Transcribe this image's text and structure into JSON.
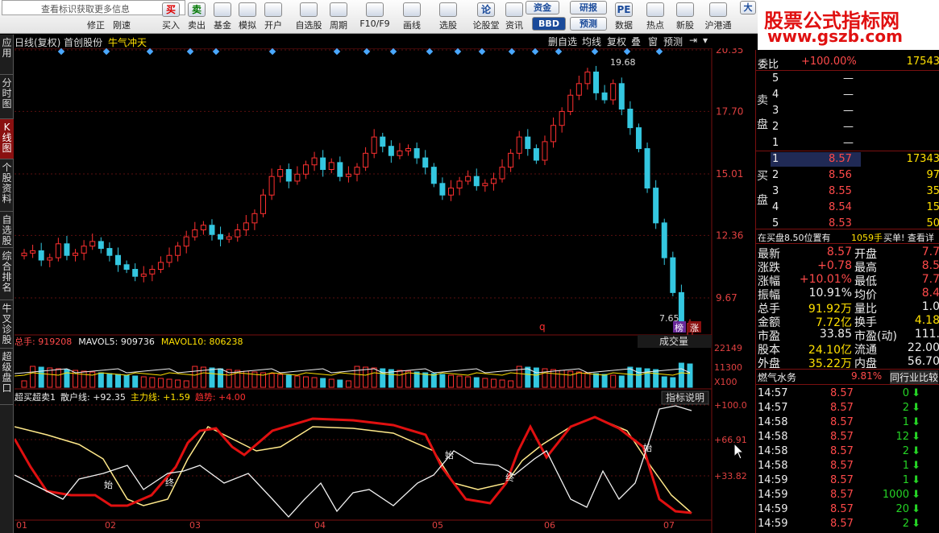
{
  "toolbar": {
    "search_placeholder": "查看标识获取更多信息",
    "buttons": [
      {
        "label": "修正",
        "icon": "arrow-icon"
      },
      {
        "label": "刚速",
        "icon": "speed-icon"
      },
      {
        "label": "买入",
        "icon": "buy-icon"
      },
      {
        "label": "卖出",
        "icon": "sell-icon"
      },
      {
        "label": "基金",
        "icon": "fund-icon"
      },
      {
        "label": "模拟",
        "icon": "hammer-icon"
      },
      {
        "label": "开户",
        "icon": "lock-icon"
      },
      {
        "label": "自选股",
        "icon": "star-icon"
      },
      {
        "label": "周期",
        "icon": "clock-icon"
      },
      {
        "label": "F10/F9",
        "icon": "f10-icon"
      },
      {
        "label": "画线",
        "icon": "pen-icon"
      },
      {
        "label": "选股",
        "icon": "screen-icon"
      },
      {
        "label": "论股堂",
        "icon": "forum-icon"
      },
      {
        "label": "资讯",
        "icon": "news-icon"
      },
      {
        "label": "数据",
        "icon": "pe-icon"
      },
      {
        "label": "热点",
        "icon": "hot-icon"
      },
      {
        "label": "新股",
        "icon": "newstock-icon"
      },
      {
        "label": "沪港通",
        "icon": "sse-hk-icon"
      }
    ],
    "buy_glyph": "买",
    "sell_glyph": "卖",
    "forum_glyph": "论",
    "pe_glyph": "PE",
    "small": {
      "fund": "资金",
      "research": "研报",
      "bbd": "BBD",
      "forecast": "预测",
      "big": "大"
    }
  },
  "watermark": {
    "line1": "股票公式指标网",
    "line2": "www.gszb.com"
  },
  "leftnav": [
    "应用",
    "分时图",
    "K线图",
    "个股资料",
    "自选股",
    "综合排名",
    "牛叉诊股",
    "超级盘口"
  ],
  "header": {
    "left": "日线(复权) 首创股份",
    "ind": "牛气冲天",
    "btns": [
      "删自选",
      "均线",
      "复权",
      "叠",
      "窗",
      "预测"
    ]
  },
  "colors": {
    "up": "#ff3030",
    "down": "#34c7e0",
    "accent": "#8a1010"
  },
  "chart_data": [
    {
      "type": "candlestick",
      "title": "日线(复权) 首创股份",
      "y_ticks": [
        "20.35",
        "17.70",
        "15.01",
        "12.36",
        "9.67"
      ],
      "annotations": {
        "high": "19.68",
        "low": "7.65",
        "q": "q",
        "bang": "榜",
        "zhang": "涨"
      },
      "x_ticks": [
        "01",
        "02",
        "03",
        "04",
        "05",
        "06",
        "07"
      ],
      "closes": [
        11.6,
        11.7,
        11.3,
        11.4,
        12.0,
        11.5,
        11.6,
        11.9,
        12.1,
        11.8,
        11.5,
        11.1,
        10.9,
        10.6,
        10.7,
        10.9,
        11.2,
        11.5,
        11.9,
        12.3,
        12.6,
        12.8,
        12.4,
        12.2,
        12.3,
        12.6,
        12.9,
        13.3,
        14.1,
        14.9,
        15.2,
        14.7,
        15.0,
        15.4,
        15.7,
        15.2,
        15.5,
        14.9,
        15.0,
        15.3,
        15.9,
        16.6,
        16.2,
        15.8,
        16.0,
        16.1,
        15.7,
        15.3,
        14.6,
        14.1,
        14.4,
        14.7,
        14.9,
        14.5,
        14.6,
        14.8,
        15.3,
        15.9,
        16.6,
        16.1,
        15.6,
        16.4,
        17.1,
        17.7,
        18.4,
        18.9,
        19.4,
        18.5,
        18.2,
        18.9,
        17.8,
        17.0,
        16.1,
        14.4,
        12.9,
        11.4,
        9.9,
        8.6,
        8.57
      ],
      "vol_ticks": [
        "22149",
        "11300",
        "X100"
      ],
      "ind_ticks": [
        "+100.0",
        "+66.91",
        "+33.82"
      ]
    },
    {
      "type": "bar",
      "title": "总手",
      "series": [
        {
          "name": "总手",
          "value": "919208"
        },
        {
          "name": "MAVOL5",
          "value": "909736"
        },
        {
          "name": "MAVOL10",
          "value": "806238"
        }
      ]
    },
    {
      "type": "line",
      "title": "超买超卖1",
      "series": [
        {
          "name": "散户线",
          "value": "+92.35"
        },
        {
          "name": "主力线",
          "value": "+1.59"
        },
        {
          "name": "趋势",
          "value": "+4.00"
        }
      ],
      "labels": {
        "start": "始",
        "end": "终"
      }
    }
  ],
  "chart_btns": {
    "volume": "成交量",
    "explain": "指标说明"
  },
  "quote": {
    "weibi": {
      "label": "委比",
      "value": "+100.00%",
      "num": "17543"
    },
    "sell_side": "卖盘",
    "buy_side": "买盘",
    "sells": [
      {
        "lv": "5",
        "p": "—"
      },
      {
        "lv": "4",
        "p": "—"
      },
      {
        "lv": "3",
        "p": "—"
      },
      {
        "lv": "2",
        "p": "—"
      },
      {
        "lv": "1",
        "p": "—"
      }
    ],
    "buys": [
      {
        "lv": "1",
        "p": "8.57",
        "v": "17343"
      },
      {
        "lv": "2",
        "p": "8.56",
        "v": "97"
      },
      {
        "lv": "3",
        "p": "8.55",
        "v": "35"
      },
      {
        "lv": "4",
        "p": "8.54",
        "v": "15"
      },
      {
        "lv": "5",
        "p": "8.53",
        "v": "50"
      }
    ],
    "msg": "在买盘8.50位置有",
    "msg_vol": "1059手",
    "msg2": "买单! 查看详",
    "stats": [
      {
        "l": "最新",
        "v": "8.57",
        "l2": "开盘",
        "v2": "7.7"
      },
      {
        "l": "涨跌",
        "v": "+0.78",
        "l2": "最高",
        "v2": "8.5"
      },
      {
        "l": "涨幅",
        "v": "+10.01%",
        "l2": "最低",
        "v2": "7.7"
      },
      {
        "l": "振幅",
        "v": "10.91%",
        "l2": "均价",
        "v2": "8.4"
      },
      {
        "l": "总手",
        "v": "91.92万",
        "l2": "量比",
        "v2": "1.0"
      },
      {
        "l": "金额",
        "v": "7.72亿",
        "l2": "换手",
        "v2": "4.18"
      },
      {
        "l": "市盈",
        "v": "33.85",
        "l2": "市盈(动)",
        "v2": "111."
      },
      {
        "l": "股本",
        "v": "24.10亿",
        "l2": "流通",
        "v2": "22.00"
      },
      {
        "l": "外盘",
        "v": "35.22万",
        "l2": "内盘",
        "v2": "56.70"
      }
    ],
    "industry": {
      "name": "燃气水务",
      "pct": "9.81%",
      "btn": "同行业比较"
    },
    "ticks": [
      {
        "t": "14:57",
        "p": "8.57",
        "v": "0"
      },
      {
        "t": "14:57",
        "p": "8.57",
        "v": "2"
      },
      {
        "t": "14:58",
        "p": "8.57",
        "v": "1"
      },
      {
        "t": "14:58",
        "p": "8.57",
        "v": "12"
      },
      {
        "t": "14:58",
        "p": "8.57",
        "v": "2"
      },
      {
        "t": "14:58",
        "p": "8.57",
        "v": "1"
      },
      {
        "t": "14:59",
        "p": "8.57",
        "v": "1"
      },
      {
        "t": "14:59",
        "p": "8.57",
        "v": "1000"
      },
      {
        "t": "14:59",
        "p": "8.57",
        "v": "20"
      },
      {
        "t": "14:59",
        "p": "8.57",
        "v": "2"
      }
    ],
    "arrow": "⬇"
  }
}
